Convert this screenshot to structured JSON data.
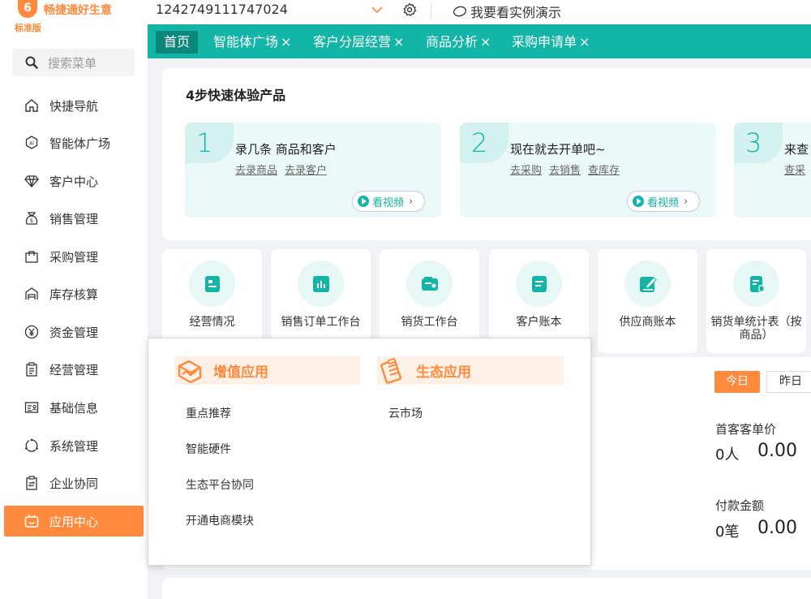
{
  "app": {
    "logo_mark": "6",
    "name": "畅捷通好生意",
    "edition": "标准版"
  },
  "sidebar": {
    "search_placeholder": "搜索菜单",
    "items": [
      {
        "label": "快捷导航",
        "icon": "home-icon"
      },
      {
        "label": "智能体广场",
        "icon": "ai-icon"
      },
      {
        "label": "客户中心",
        "icon": "diamond-icon"
      },
      {
        "label": "销售管理",
        "icon": "sales-bag-icon"
      },
      {
        "label": "采购管理",
        "icon": "purchase-bag-icon"
      },
      {
        "label": "库存核算",
        "icon": "warehouse-icon"
      },
      {
        "label": "资金管理",
        "icon": "yen-icon"
      },
      {
        "label": "经营管理",
        "icon": "clipboard-icon"
      },
      {
        "label": "基础信息",
        "icon": "id-card-icon"
      },
      {
        "label": "系统管理",
        "icon": "cycle-icon"
      },
      {
        "label": "企业协同",
        "icon": "sync-clipboard-icon"
      },
      {
        "label": "应用中心",
        "icon": "app-center-icon"
      }
    ],
    "active_index": 11
  },
  "topbar": {
    "account": "1242749111747024",
    "demo_label": "我要看实例演示"
  },
  "tabs": [
    {
      "label": "首页",
      "closable": false,
      "active": true
    },
    {
      "label": "智能体广场",
      "closable": true
    },
    {
      "label": "客户分层经营",
      "closable": true
    },
    {
      "label": "商品分析",
      "closable": true
    },
    {
      "label": "采购申请单",
      "closable": true
    }
  ],
  "tab_close": "×",
  "quickstart": {
    "title": "4步快速体验产品",
    "steps": [
      {
        "num": "1",
        "title": "录几条 商品和客户",
        "links": [
          "去录商品",
          "去录客户"
        ],
        "video": "看视频"
      },
      {
        "num": "2",
        "title": "现在就去开单吧~",
        "links": [
          "去采购",
          "去销售",
          "查库存"
        ],
        "video": "看视频"
      },
      {
        "num": "3",
        "title": "来查",
        "links": [
          "查采"
        ],
        "video": ""
      }
    ]
  },
  "tiles": [
    {
      "label": "经营情况",
      "icon": "report-icon"
    },
    {
      "label": "销售订单工作台",
      "icon": "bar-chart-icon"
    },
    {
      "label": "销货工作台",
      "icon": "truck-icon"
    },
    {
      "label": "客户账本",
      "icon": "ledger-icon"
    },
    {
      "label": "供应商账本",
      "icon": "edit-icon"
    },
    {
      "label": "销货单统计表（按商品）",
      "icon": "document-icon"
    }
  ],
  "stats": {
    "today": "今日",
    "yesterday": "昨日",
    "first_label": "首客客单价",
    "first_count": "0人",
    "first_value": "0.00",
    "second_label": "付款金额",
    "second_count": "0笔",
    "second_value": "0.00"
  },
  "app_panel": {
    "groups": [
      {
        "title": "增值应用",
        "icon": "value-app-icon",
        "items": [
          "重点推荐",
          "智能硬件",
          "生态平台协同",
          "开通电商模块"
        ]
      },
      {
        "title": "生态应用",
        "icon": "eco-app-icon",
        "items": [
          "云市场"
        ]
      }
    ]
  },
  "colors": {
    "accent_orange": "#ff8a3d",
    "teal": "#13b5a7",
    "teal_dark": "#0c877c"
  }
}
